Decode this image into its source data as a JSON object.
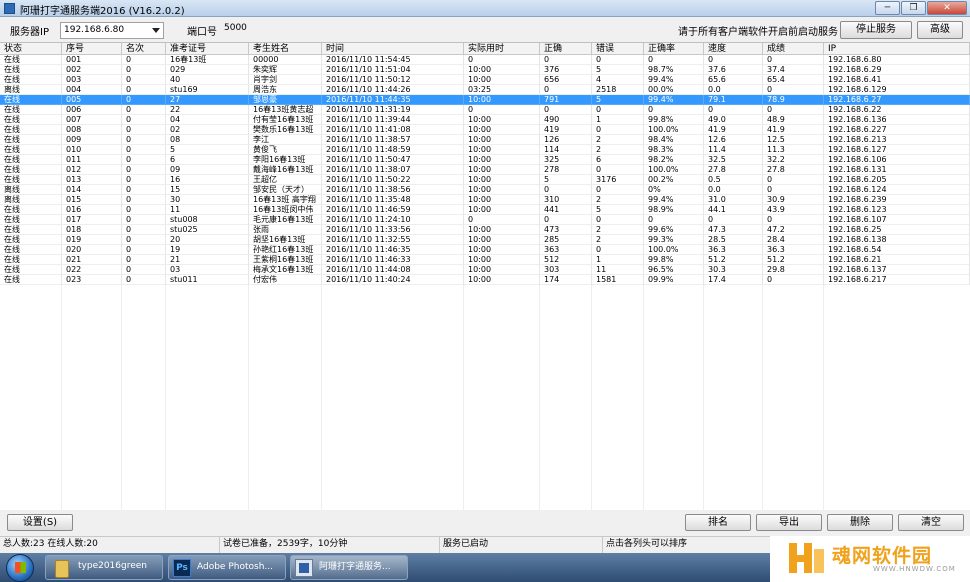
{
  "window": {
    "title": "阿珊打字通服务端2016 (V16.2.0.2)",
    "minimize": "─",
    "restore": "❐",
    "close": "✕"
  },
  "toolbar": {
    "server_ip_label": "服务器IP",
    "server_ip_value": "192.168.6.80",
    "port_label": "端口号",
    "port_value": "5000",
    "hint": "请于所有客户端软件开启前启动服务",
    "stop_button": "停止服务",
    "advanced_button": "高级"
  },
  "table": {
    "columns": [
      "状态",
      "序号",
      "名次",
      "准考证号",
      "考生姓名",
      "时间",
      "实际用时",
      "正确",
      "错误",
      "正确率",
      "速度",
      "成绩",
      "IP"
    ],
    "selected_row": 4,
    "rows": [
      [
        "在线",
        "001",
        "0",
        "16春13班",
        "00000",
        "2016/11/10 11:54:45",
        "0",
        "0",
        "0",
        "0",
        "0",
        "0",
        "192.168.6.80"
      ],
      [
        "在线",
        "002",
        "0",
        "029",
        "朱奕辉",
        "2016/11/10 11:51:04",
        "10:00",
        "376",
        "5",
        "98.7%",
        "37.6",
        "37.4",
        "192.168.6.29"
      ],
      [
        "在线",
        "003",
        "0",
        "40",
        "肖宇剑",
        "2016/11/10 11:50:12",
        "10:00",
        "656",
        "4",
        "99.4%",
        "65.6",
        "65.4",
        "192.168.6.41"
      ],
      [
        "离线",
        "004",
        "0",
        "stu169",
        "周浩东",
        "2016/11/10 11:44:26",
        "03:25",
        "0",
        "2518",
        "00.0%",
        "0.0",
        "0",
        "192.168.6.129"
      ],
      [
        "在线",
        "005",
        "0",
        "27",
        "邹恩豪",
        "2016/11/10 11:44:35",
        "10:00",
        "791",
        "5",
        "99.4%",
        "79.1",
        "78.9",
        "192.168.6.27"
      ],
      [
        "在线",
        "006",
        "0",
        "22",
        "16春13班黄志超",
        "2016/11/10 11:31:19",
        "0",
        "0",
        "0",
        "0",
        "0",
        "0",
        "192.168.6.22"
      ],
      [
        "在线",
        "007",
        "0",
        "04",
        "付有莹16春13班",
        "2016/11/10 11:39:44",
        "10:00",
        "490",
        "1",
        "99.8%",
        "49.0",
        "48.9",
        "192.168.6.136"
      ],
      [
        "在线",
        "008",
        "0",
        "02",
        "樊数乐16春13班",
        "2016/11/10 11:41:08",
        "10:00",
        "419",
        "0",
        "100.0%",
        "41.9",
        "41.9",
        "192.168.6.227"
      ],
      [
        "在线",
        "009",
        "0",
        "08",
        "李江",
        "2016/11/10 11:38:57",
        "10:00",
        "126",
        "2",
        "98.4%",
        "12.6",
        "12.5",
        "192.168.6.213"
      ],
      [
        "在线",
        "010",
        "0",
        "5",
        "黄俊飞",
        "2016/11/10 11:48:59",
        "10:00",
        "114",
        "2",
        "98.3%",
        "11.4",
        "11.3",
        "192.168.6.127"
      ],
      [
        "在线",
        "011",
        "0",
        "6",
        "李阳16春13班",
        "2016/11/10 11:50:47",
        "10:00",
        "325",
        "6",
        "98.2%",
        "32.5",
        "32.2",
        "192.168.6.106"
      ],
      [
        "在线",
        "012",
        "0",
        "09",
        "戴海峰16春13班",
        "2016/11/10 11:38:07",
        "10:00",
        "278",
        "0",
        "100.0%",
        "27.8",
        "27.8",
        "192.168.6.131"
      ],
      [
        "在线",
        "013",
        "0",
        "16",
        "王超亿",
        "2016/11/10 11:50:22",
        "10:00",
        "5",
        "3176",
        "00.2%",
        "0.5",
        "0",
        "192.168.6.205"
      ],
      [
        "离线",
        "014",
        "0",
        "15",
        "邹安民（天才）",
        "2016/11/10 11:38:56",
        "10:00",
        "0",
        "0",
        "0%",
        "0.0",
        "0",
        "192.168.6.124"
      ],
      [
        "离线",
        "015",
        "0",
        "30",
        "16春13班 高宇翔",
        "2016/11/10 11:35:48",
        "10:00",
        "310",
        "2",
        "99.4%",
        "31.0",
        "30.9",
        "192.168.6.239"
      ],
      [
        "在线",
        "016",
        "0",
        "11",
        "16春13班闵中伟",
        "2016/11/10 11:46:59",
        "10:00",
        "441",
        "5",
        "98.9%",
        "44.1",
        "43.9",
        "192.168.6.123"
      ],
      [
        "在线",
        "017",
        "0",
        "stu008",
        "毛元康16春13班",
        "2016/11/10 11:24:10",
        "0",
        "0",
        "0",
        "0",
        "0",
        "0",
        "192.168.6.107"
      ],
      [
        "在线",
        "018",
        "0",
        "stu025",
        "张雨",
        "2016/11/10 11:33:56",
        "10:00",
        "473",
        "2",
        "99.6%",
        "47.3",
        "47.2",
        "192.168.6.25"
      ],
      [
        "在线",
        "019",
        "0",
        "20",
        "胡坚16春13班",
        "2016/11/10 11:32:55",
        "10:00",
        "285",
        "2",
        "99.3%",
        "28.5",
        "28.4",
        "192.168.6.138"
      ],
      [
        "在线",
        "020",
        "0",
        "19",
        "孙艳红16春13班",
        "2016/11/10 11:46:35",
        "10:00",
        "363",
        "0",
        "100.0%",
        "36.3",
        "36.3",
        "192.168.6.54"
      ],
      [
        "在线",
        "021",
        "0",
        "21",
        "王紫桐16春13班",
        "2016/11/10 11:46:33",
        "10:00",
        "512",
        "1",
        "99.8%",
        "51.2",
        "51.2",
        "192.168.6.21"
      ],
      [
        "在线",
        "022",
        "0",
        "03",
        "梅承文16春13班",
        "2016/11/10 11:44:08",
        "10:00",
        "303",
        "11",
        "96.5%",
        "30.3",
        "29.8",
        "192.168.6.137"
      ],
      [
        "在线",
        "023",
        "0",
        "stu011",
        "付宏伟",
        "2016/11/10 11:40:24",
        "10:00",
        "174",
        "1581",
        "09.9%",
        "17.4",
        "0",
        "192.168.6.217"
      ]
    ]
  },
  "bottom": {
    "settings_button": "设置(S)",
    "rank_button": "排名",
    "export_button": "导出",
    "delete_button": "删除",
    "clear_button": "清空"
  },
  "status": {
    "counts": "总人数:23  在线人数:20",
    "exam": "试卷已准备，2539字，10分钟",
    "service": "服务已启动",
    "sort_hint": "点击各列头可以排序"
  },
  "taskbar": {
    "items": [
      "type2016green",
      "Adobe Photosh...",
      "阿珊打字通服务..."
    ]
  },
  "watermark": {
    "text": "魂网软件园",
    "url": "WWW.HNWDW.COM"
  }
}
